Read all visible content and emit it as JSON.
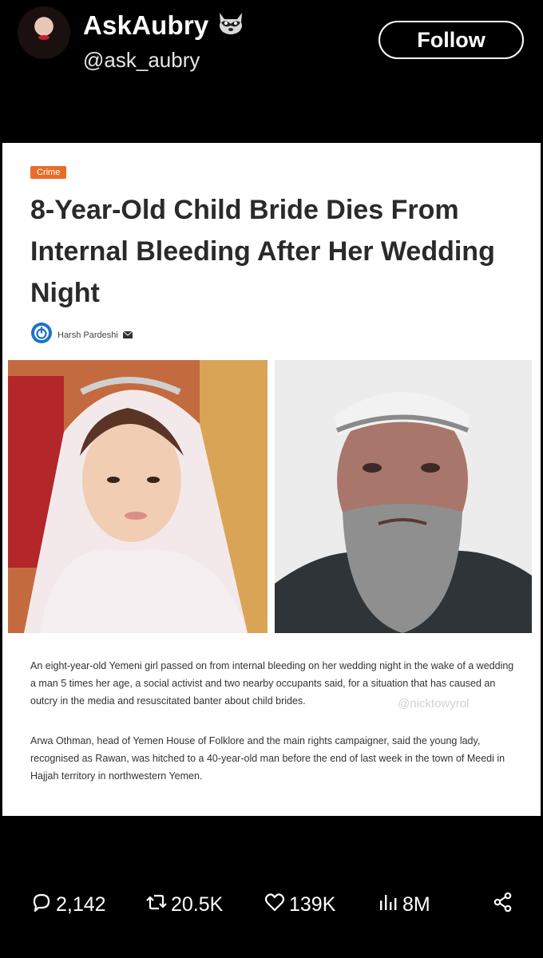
{
  "post": {
    "display_name": "AskAubry",
    "handle": "@ask_aubry",
    "follow_label": "Follow"
  },
  "article": {
    "category": "Crime",
    "headline": "8-Year-Old Child Bride Dies From Internal Bleeding After Her Wedding Night",
    "author": "Harsh Pardeshi",
    "paragraph_1": "An eight-year-old Yemeni girl passed on from internal bleeding on her wedding night in the wake of a wedding a man 5 times her age, a social activist and two nearby occupants said, for a situation that has caused an outcry in the media and resuscitated banter about child brides.",
    "paragraph_2": "Arwa Othman, head of Yemen House of Folklore and the main rights campaigner, said the young lady, recognised as Rawan, was hitched to a 40-year-old man before the end of last week in the town of Meedi in Hajjah territory in northwestern Yemen.",
    "watermark": "@nicktowyrol"
  },
  "actions": {
    "replies": "2,142",
    "reposts": "20.5K",
    "likes": "139K",
    "views": "8M"
  },
  "icons": {
    "reply": "speech-bubble-icon",
    "repost": "repost-arrows-icon",
    "like": "heart-icon",
    "views": "bar-chart-icon",
    "share": "share-nodes-icon",
    "badge": "raccoon-icon"
  },
  "colors": {
    "background": "#000000",
    "category_badge": "#e76d2b",
    "author_logo": "#1a73c7"
  }
}
